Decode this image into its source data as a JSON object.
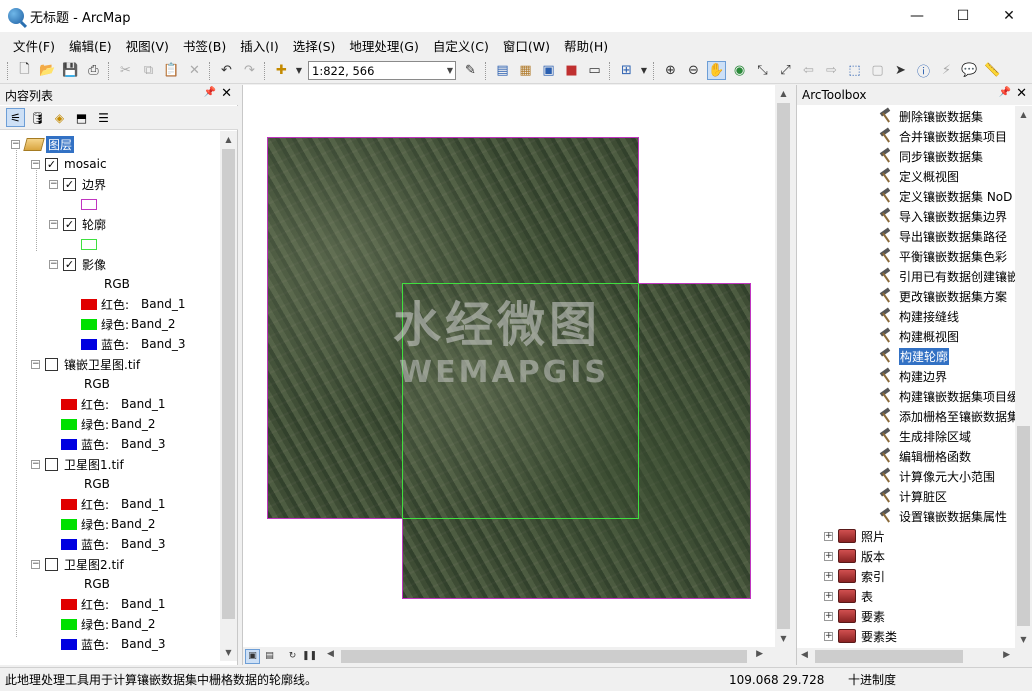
{
  "window": {
    "title": "无标题 - ArcMap",
    "minimize": "—",
    "maximize": "☐",
    "close": "✕"
  },
  "menu": [
    "文件(F)",
    "编辑(E)",
    "视图(V)",
    "书签(B)",
    "插入(I)",
    "选择(S)",
    "地理处理(G)",
    "自定义(C)",
    "窗口(W)",
    "帮助(H)"
  ],
  "toolbar": {
    "scale": "1:822, 566"
  },
  "toc": {
    "title": "内容列表",
    "root": "图层",
    "groups": [
      {
        "name": "mosaic",
        "checked": true,
        "children": [
          {
            "name": "边界",
            "checked": true,
            "color": "#c035c0"
          },
          {
            "name": "轮廓",
            "checked": true,
            "color": "#3fe03f"
          },
          {
            "name": "影像",
            "checked": true,
            "rgb": "RGB",
            "bands": [
              {
                "label": "红色:",
                "band": "Band_1",
                "color": "#e00000"
              },
              {
                "label": "绿色:",
                "band": "Band_2",
                "color": "#00e000"
              },
              {
                "label": "蓝色:",
                "band": "Band_3",
                "color": "#0000e0"
              }
            ]
          }
        ]
      },
      {
        "name": "镶嵌卫星图.tif",
        "checked": false,
        "rgb": "RGB",
        "bands": [
          {
            "label": "红色:",
            "band": "Band_1",
            "color": "#e00000"
          },
          {
            "label": "绿色:",
            "band": "Band_2",
            "color": "#00e000"
          },
          {
            "label": "蓝色:",
            "band": "Band_3",
            "color": "#0000e0"
          }
        ]
      },
      {
        "name": "卫星图1.tif",
        "checked": false,
        "rgb": "RGB",
        "bands": [
          {
            "label": "红色:",
            "band": "Band_1",
            "color": "#e00000"
          },
          {
            "label": "绿色:",
            "band": "Band_2",
            "color": "#00e000"
          },
          {
            "label": "蓝色:",
            "band": "Band_3",
            "color": "#0000e0"
          }
        ]
      },
      {
        "name": "卫星图2.tif",
        "checked": false,
        "rgb": "RGB",
        "bands": [
          {
            "label": "红色:",
            "band": "Band_1",
            "color": "#e00000"
          },
          {
            "label": "绿色:",
            "band": "Band_2",
            "color": "#00e000"
          },
          {
            "label": "蓝色:",
            "band": "Band_3",
            "color": "#0000e0"
          }
        ]
      }
    ]
  },
  "map": {
    "watermark_cn": "水经微图",
    "watermark_en": "WEMAPGIS"
  },
  "toolbox": {
    "title": "ArcToolbox",
    "tools": [
      "删除镶嵌数据集",
      "合并镶嵌数据集项目",
      "同步镶嵌数据集",
      "定义概视图",
      "定义镶嵌数据集 NoD",
      "导入镶嵌数据集边界",
      "导出镶嵌数据集路径",
      "平衡镶嵌数据集色彩",
      "引用已有数据创建镶嵌",
      "更改镶嵌数据集方案",
      "构建接缝线",
      "构建概视图",
      "构建轮廓",
      "构建边界",
      "构建镶嵌数据集项目缓",
      "添加栅格至镶嵌数据集",
      "生成排除区域",
      "编辑栅格函数",
      "计算像元大小范围",
      "计算脏区",
      "设置镶嵌数据集属性"
    ],
    "selected_tool": "构建轮廓",
    "toolsets": [
      "照片",
      "版本",
      "索引",
      "表",
      "要素",
      "要素类"
    ]
  },
  "status": {
    "message": "此地理处理工具用于计算镶嵌数据集中栅格数据的轮廓线。",
    "coords": "109.068  29.728",
    "units": "十进制度"
  }
}
